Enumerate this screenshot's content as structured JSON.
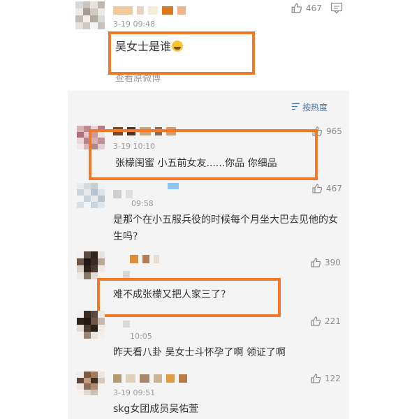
{
  "colors": {
    "highlight": "#f07a2a",
    "reply_bg": "#f4f4f4",
    "sort_link": "#4a6fa5",
    "timestamp": "#9a9a9a"
  },
  "main_comment": {
    "timestamp": "3-19 09:48",
    "text": "吴女士是谁",
    "emoji": "crying-laughing-emoji",
    "likes": "467",
    "view_original": "查看原微博"
  },
  "reply_sort": {
    "label": "按热度",
    "icon": "sort-lines-icon"
  },
  "replies": [
    {
      "timestamp": "3-19 10:10",
      "text": "张檬闺蜜 小五前女友......你品 你细品",
      "likes": "965"
    },
    {
      "timestamp": "09:58",
      "text": "是那个在小五服兵役的时候每个月坐大巴去见他的女生吗?",
      "likes": "467"
    },
    {
      "timestamp": "",
      "text": "难不成张檬又把人家三了?",
      "likes": "390"
    },
    {
      "timestamp": "10:05",
      "text": "昨天看八卦 吴女士斗怀孕了啊 领证了啊",
      "likes": "221"
    },
    {
      "timestamp": "3-19 09:51",
      "text": "skg女团成员吴佑萱",
      "likes": "122"
    }
  ],
  "icons": {
    "like": "thumbs-up-icon",
    "reply": "comment-icon"
  }
}
